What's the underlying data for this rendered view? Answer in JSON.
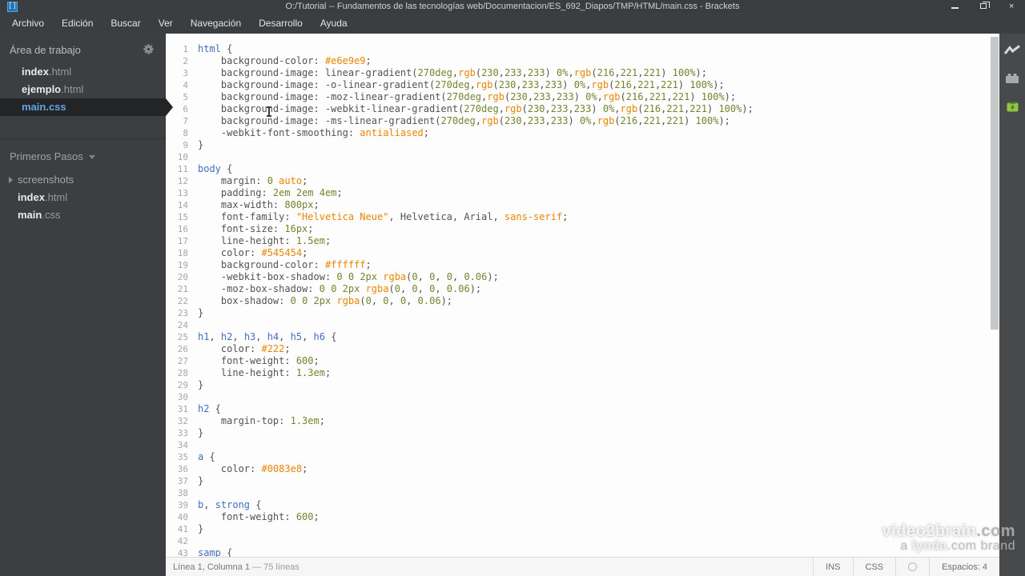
{
  "window": {
    "title": "O:/Tutorial -- Fundamentos de las tecnologías web/Documentacion/ES_692_Diapos/TMP/HTML/main.css - Brackets",
    "app_icon": "brackets-logo",
    "app_icon_glyph": "[]",
    "controls": [
      "minimize-icon",
      "restore-icon",
      "close-icon"
    ]
  },
  "menu": {
    "items": [
      "Archivo",
      "Edición",
      "Buscar",
      "Ver",
      "Navegación",
      "Desarrollo",
      "Ayuda"
    ]
  },
  "sidebar": {
    "working_set": {
      "title": "Área de trabajo",
      "gear_icon": "gear-icon",
      "files": [
        {
          "name": "index",
          "ext": ".html"
        },
        {
          "name": "ejemplo",
          "ext": ".html"
        },
        {
          "name": "main",
          "ext": ".css",
          "selected": true
        }
      ]
    },
    "project": {
      "name": "Primeros Pasos",
      "folder": {
        "label": "screenshots"
      },
      "files": [
        {
          "name": "index",
          "ext": ".html"
        },
        {
          "name": "main",
          "ext": ".css"
        }
      ]
    }
  },
  "editor": {
    "language": "css",
    "lines": [
      {
        "n": 1,
        "seg": [
          [
            "s",
            "html"
          ],
          [
            "p",
            " {"
          ]
        ]
      },
      {
        "n": 2,
        "seg": [
          [
            "p",
            "    background-color: "
          ],
          [
            "a",
            "#e6e9e9"
          ],
          [
            "p",
            ";"
          ]
        ]
      },
      {
        "n": 3,
        "seg": [
          [
            "p",
            "    background-image: linear-gradient("
          ],
          [
            "n",
            "270deg"
          ],
          [
            "p",
            ","
          ],
          [
            "a",
            "rgb"
          ],
          [
            "p",
            "("
          ],
          [
            "n",
            "230"
          ],
          [
            "p",
            ","
          ],
          [
            "n",
            "233"
          ],
          [
            "p",
            ","
          ],
          [
            "n",
            "233"
          ],
          [
            "p",
            ") "
          ],
          [
            "n",
            "0%"
          ],
          [
            "p",
            ","
          ],
          [
            "a",
            "rgb"
          ],
          [
            "p",
            "("
          ],
          [
            "n",
            "216"
          ],
          [
            "p",
            ","
          ],
          [
            "n",
            "221"
          ],
          [
            "p",
            ","
          ],
          [
            "n",
            "221"
          ],
          [
            "p",
            ") "
          ],
          [
            "n",
            "100%"
          ],
          [
            "p",
            ");"
          ]
        ]
      },
      {
        "n": 4,
        "seg": [
          [
            "p",
            "    background-image: -o-linear-gradient("
          ],
          [
            "n",
            "270deg"
          ],
          [
            "p",
            ","
          ],
          [
            "a",
            "rgb"
          ],
          [
            "p",
            "("
          ],
          [
            "n",
            "230"
          ],
          [
            "p",
            ","
          ],
          [
            "n",
            "233"
          ],
          [
            "p",
            ","
          ],
          [
            "n",
            "233"
          ],
          [
            "p",
            ") "
          ],
          [
            "n",
            "0%"
          ],
          [
            "p",
            ","
          ],
          [
            "a",
            "rgb"
          ],
          [
            "p",
            "("
          ],
          [
            "n",
            "216"
          ],
          [
            "p",
            ","
          ],
          [
            "n",
            "221"
          ],
          [
            "p",
            ","
          ],
          [
            "n",
            "221"
          ],
          [
            "p",
            ") "
          ],
          [
            "n",
            "100%"
          ],
          [
            "p",
            ");"
          ]
        ]
      },
      {
        "n": 5,
        "seg": [
          [
            "p",
            "    background-image: -moz-linear-gradient("
          ],
          [
            "n",
            "270deg"
          ],
          [
            "p",
            ","
          ],
          [
            "a",
            "rgb"
          ],
          [
            "p",
            "("
          ],
          [
            "n",
            "230"
          ],
          [
            "p",
            ","
          ],
          [
            "n",
            "233"
          ],
          [
            "p",
            ","
          ],
          [
            "n",
            "233"
          ],
          [
            "p",
            ") "
          ],
          [
            "n",
            "0%"
          ],
          [
            "p",
            ","
          ],
          [
            "a",
            "rgb"
          ],
          [
            "p",
            "("
          ],
          [
            "n",
            "216"
          ],
          [
            "p",
            ","
          ],
          [
            "n",
            "221"
          ],
          [
            "p",
            ","
          ],
          [
            "n",
            "221"
          ],
          [
            "p",
            ") "
          ],
          [
            "n",
            "100%"
          ],
          [
            "p",
            ");"
          ]
        ]
      },
      {
        "n": 6,
        "seg": [
          [
            "p",
            "    background-image: -webkit-linear-gradient("
          ],
          [
            "n",
            "270deg"
          ],
          [
            "p",
            ","
          ],
          [
            "a",
            "rgb"
          ],
          [
            "p",
            "("
          ],
          [
            "n",
            "230"
          ],
          [
            "p",
            ","
          ],
          [
            "n",
            "233"
          ],
          [
            "p",
            ","
          ],
          [
            "n",
            "233"
          ],
          [
            "p",
            ") "
          ],
          [
            "n",
            "0%"
          ],
          [
            "p",
            ","
          ],
          [
            "a",
            "rgb"
          ],
          [
            "p",
            "("
          ],
          [
            "n",
            "216"
          ],
          [
            "p",
            ","
          ],
          [
            "n",
            "221"
          ],
          [
            "p",
            ","
          ],
          [
            "n",
            "221"
          ],
          [
            "p",
            ") "
          ],
          [
            "n",
            "100%"
          ],
          [
            "p",
            ");"
          ]
        ]
      },
      {
        "n": 7,
        "seg": [
          [
            "p",
            "    background-image: -ms-linear-gradient("
          ],
          [
            "n",
            "270deg"
          ],
          [
            "p",
            ","
          ],
          [
            "a",
            "rgb"
          ],
          [
            "p",
            "("
          ],
          [
            "n",
            "230"
          ],
          [
            "p",
            ","
          ],
          [
            "n",
            "233"
          ],
          [
            "p",
            ","
          ],
          [
            "n",
            "233"
          ],
          [
            "p",
            ") "
          ],
          [
            "n",
            "0%"
          ],
          [
            "p",
            ","
          ],
          [
            "a",
            "rgb"
          ],
          [
            "p",
            "("
          ],
          [
            "n",
            "216"
          ],
          [
            "p",
            ","
          ],
          [
            "n",
            "221"
          ],
          [
            "p",
            ","
          ],
          [
            "n",
            "221"
          ],
          [
            "p",
            ") "
          ],
          [
            "n",
            "100%"
          ],
          [
            "p",
            ");"
          ]
        ]
      },
      {
        "n": 8,
        "seg": [
          [
            "p",
            "    -webkit-font-smoothing: "
          ],
          [
            "a",
            "antialiased"
          ],
          [
            "p",
            ";"
          ]
        ]
      },
      {
        "n": 9,
        "seg": [
          [
            "p",
            "}"
          ]
        ]
      },
      {
        "n": 10,
        "seg": []
      },
      {
        "n": 11,
        "seg": [
          [
            "s",
            "body"
          ],
          [
            "p",
            " {"
          ]
        ]
      },
      {
        "n": 12,
        "seg": [
          [
            "p",
            "    margin: "
          ],
          [
            "n",
            "0"
          ],
          [
            "p",
            " "
          ],
          [
            "a",
            "auto"
          ],
          [
            "p",
            ";"
          ]
        ]
      },
      {
        "n": 13,
        "seg": [
          [
            "p",
            "    padding: "
          ],
          [
            "n",
            "2em"
          ],
          [
            "p",
            " "
          ],
          [
            "n",
            "2em"
          ],
          [
            "p",
            " "
          ],
          [
            "n",
            "4em"
          ],
          [
            "p",
            ";"
          ]
        ]
      },
      {
        "n": 14,
        "seg": [
          [
            "p",
            "    max-width: "
          ],
          [
            "n",
            "800px"
          ],
          [
            "p",
            ";"
          ]
        ]
      },
      {
        "n": 15,
        "seg": [
          [
            "p",
            "    font-family: "
          ],
          [
            "a",
            "\"Helvetica Neue\""
          ],
          [
            "p",
            ", Helvetica, Arial, "
          ],
          [
            "a",
            "sans-serif"
          ],
          [
            "p",
            ";"
          ]
        ]
      },
      {
        "n": 16,
        "seg": [
          [
            "p",
            "    font-size: "
          ],
          [
            "n",
            "16px"
          ],
          [
            "p",
            ";"
          ]
        ]
      },
      {
        "n": 17,
        "seg": [
          [
            "p",
            "    line-height: "
          ],
          [
            "n",
            "1.5em"
          ],
          [
            "p",
            ";"
          ]
        ]
      },
      {
        "n": 18,
        "seg": [
          [
            "p",
            "    color: "
          ],
          [
            "a",
            "#545454"
          ],
          [
            "p",
            ";"
          ]
        ]
      },
      {
        "n": 19,
        "seg": [
          [
            "p",
            "    background-color: "
          ],
          [
            "a",
            "#ffffff"
          ],
          [
            "p",
            ";"
          ]
        ]
      },
      {
        "n": 20,
        "seg": [
          [
            "p",
            "    -webkit-box-shadow: "
          ],
          [
            "n",
            "0"
          ],
          [
            "p",
            " "
          ],
          [
            "n",
            "0"
          ],
          [
            "p",
            " "
          ],
          [
            "n",
            "2px"
          ],
          [
            "p",
            " "
          ],
          [
            "a",
            "rgba"
          ],
          [
            "p",
            "("
          ],
          [
            "n",
            "0"
          ],
          [
            "p",
            ", "
          ],
          [
            "n",
            "0"
          ],
          [
            "p",
            ", "
          ],
          [
            "n",
            "0"
          ],
          [
            "p",
            ", "
          ],
          [
            "n",
            "0.06"
          ],
          [
            "p",
            ");"
          ]
        ]
      },
      {
        "n": 21,
        "seg": [
          [
            "p",
            "    -moz-box-shadow: "
          ],
          [
            "n",
            "0"
          ],
          [
            "p",
            " "
          ],
          [
            "n",
            "0"
          ],
          [
            "p",
            " "
          ],
          [
            "n",
            "2px"
          ],
          [
            "p",
            " "
          ],
          [
            "a",
            "rgba"
          ],
          [
            "p",
            "("
          ],
          [
            "n",
            "0"
          ],
          [
            "p",
            ", "
          ],
          [
            "n",
            "0"
          ],
          [
            "p",
            ", "
          ],
          [
            "n",
            "0"
          ],
          [
            "p",
            ", "
          ],
          [
            "n",
            "0.06"
          ],
          [
            "p",
            ");"
          ]
        ]
      },
      {
        "n": 22,
        "seg": [
          [
            "p",
            "    box-shadow: "
          ],
          [
            "n",
            "0"
          ],
          [
            "p",
            " "
          ],
          [
            "n",
            "0"
          ],
          [
            "p",
            " "
          ],
          [
            "n",
            "2px"
          ],
          [
            "p",
            " "
          ],
          [
            "a",
            "rgba"
          ],
          [
            "p",
            "("
          ],
          [
            "n",
            "0"
          ],
          [
            "p",
            ", "
          ],
          [
            "n",
            "0"
          ],
          [
            "p",
            ", "
          ],
          [
            "n",
            "0"
          ],
          [
            "p",
            ", "
          ],
          [
            "n",
            "0.06"
          ],
          [
            "p",
            ");"
          ]
        ]
      },
      {
        "n": 23,
        "seg": [
          [
            "p",
            "}"
          ]
        ]
      },
      {
        "n": 24,
        "seg": []
      },
      {
        "n": 25,
        "seg": [
          [
            "s",
            "h1"
          ],
          [
            "p",
            ", "
          ],
          [
            "s",
            "h2"
          ],
          [
            "p",
            ", "
          ],
          [
            "s",
            "h3"
          ],
          [
            "p",
            ", "
          ],
          [
            "s",
            "h4"
          ],
          [
            "p",
            ", "
          ],
          [
            "s",
            "h5"
          ],
          [
            "p",
            ", "
          ],
          [
            "s",
            "h6"
          ],
          [
            "p",
            " {"
          ]
        ]
      },
      {
        "n": 26,
        "seg": [
          [
            "p",
            "    color: "
          ],
          [
            "a",
            "#222"
          ],
          [
            "p",
            ";"
          ]
        ]
      },
      {
        "n": 27,
        "seg": [
          [
            "p",
            "    font-weight: "
          ],
          [
            "n",
            "600"
          ],
          [
            "p",
            ";"
          ]
        ]
      },
      {
        "n": 28,
        "seg": [
          [
            "p",
            "    line-height: "
          ],
          [
            "n",
            "1.3em"
          ],
          [
            "p",
            ";"
          ]
        ]
      },
      {
        "n": 29,
        "seg": [
          [
            "p",
            "}"
          ]
        ]
      },
      {
        "n": 30,
        "seg": []
      },
      {
        "n": 31,
        "seg": [
          [
            "s",
            "h2"
          ],
          [
            "p",
            " {"
          ]
        ]
      },
      {
        "n": 32,
        "seg": [
          [
            "p",
            "    margin-top: "
          ],
          [
            "n",
            "1.3em"
          ],
          [
            "p",
            ";"
          ]
        ]
      },
      {
        "n": 33,
        "seg": [
          [
            "p",
            "}"
          ]
        ]
      },
      {
        "n": 34,
        "seg": []
      },
      {
        "n": 35,
        "seg": [
          [
            "s",
            "a"
          ],
          [
            "p",
            " {"
          ]
        ]
      },
      {
        "n": 36,
        "seg": [
          [
            "p",
            "    color: "
          ],
          [
            "a",
            "#0083e8"
          ],
          [
            "p",
            ";"
          ]
        ]
      },
      {
        "n": 37,
        "seg": [
          [
            "p",
            "}"
          ]
        ]
      },
      {
        "n": 38,
        "seg": []
      },
      {
        "n": 39,
        "seg": [
          [
            "s",
            "b"
          ],
          [
            "p",
            ", "
          ],
          [
            "s",
            "strong"
          ],
          [
            "p",
            " {"
          ]
        ]
      },
      {
        "n": 40,
        "seg": [
          [
            "p",
            "    font-weight: "
          ],
          [
            "n",
            "600"
          ],
          [
            "p",
            ";"
          ]
        ]
      },
      {
        "n": 41,
        "seg": [
          [
            "p",
            "}"
          ]
        ]
      },
      {
        "n": 42,
        "seg": []
      },
      {
        "n": 43,
        "seg": [
          [
            "s",
            "samp"
          ],
          [
            "p",
            " {"
          ]
        ]
      }
    ]
  },
  "statusbar": {
    "position": "Línea 1, Columna 1",
    "line_count": "— 75 líneas",
    "overwrite": "INS",
    "language": "CSS",
    "lint_icon": "lint-status-circle-icon",
    "spaces": "Espacios: 4"
  },
  "toolbar": {
    "icons": [
      "live-preview-icon",
      "extension-manager-icon",
      "extension-gift-icon"
    ]
  },
  "watermark": {
    "brand": "video2brain",
    "brand_suffix": ".com",
    "tagline_prefix": "a ",
    "tagline_brand": "lynda",
    "tagline_suffix": ".com brand"
  },
  "colors": {
    "selector": "#446fbd",
    "plain": "#535353",
    "number": "#738530",
    "atom": "#e88501",
    "sidebar_bg": "#3c3f41",
    "selected_row_bg": "#222426",
    "editor_bg": "#fdfdfd"
  }
}
